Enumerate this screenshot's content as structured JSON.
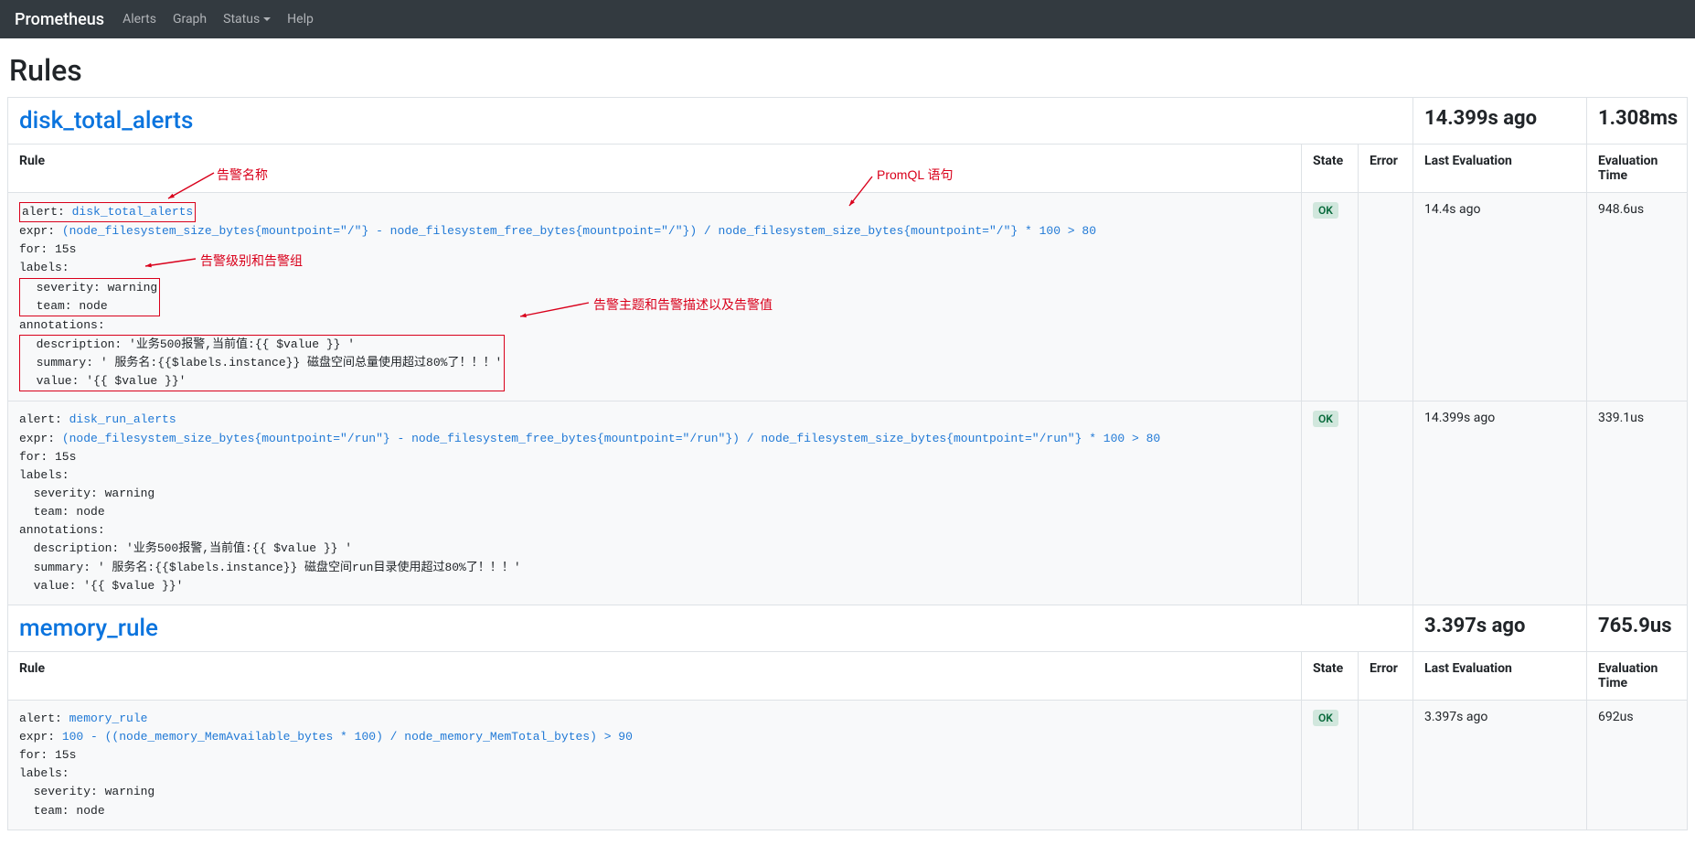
{
  "nav": {
    "brand": "Prometheus",
    "items": [
      "Alerts",
      "Graph",
      "Status",
      "Help"
    ]
  },
  "page_title": "Rules",
  "columns": {
    "rule": "Rule",
    "state": "State",
    "error": "Error",
    "last": "Last Evaluation",
    "eval": "Evaluation Time"
  },
  "state_ok": "OK",
  "annotations_ui": {
    "alert_name": "告警名称",
    "promql": "PromQL 语句",
    "level_group": "告警级别和告警组",
    "subject_desc": "告警主题和告警描述以及告警值"
  },
  "groups": [
    {
      "name": "disk_total_alerts",
      "ago": "14.399s ago",
      "duration": "1.308ms",
      "rules": [
        {
          "annotated": true,
          "state": "OK",
          "error": "",
          "last": "14.4s ago",
          "eval": "948.6us",
          "alert": "disk_total_alerts",
          "expr": "(node_filesystem_size_bytes{mountpoint=\"/\"} - node_filesystem_free_bytes{mountpoint=\"/\"}) / node_filesystem_size_bytes{mountpoint=\"/\"} * 100 > 80",
          "for": "15s",
          "labels": {
            "severity": "warning",
            "team": "node"
          },
          "annotations": {
            "description": "'业务500报警,当前值:{{ $value }} '",
            "summary": "' 服务名:{{$labels.instance}} 磁盘空间总量使用超过80%了！！！'",
            "value": "'{{ $value }}'"
          }
        },
        {
          "annotated": false,
          "state": "OK",
          "error": "",
          "last": "14.399s ago",
          "eval": "339.1us",
          "alert": "disk_run_alerts",
          "expr": "(node_filesystem_size_bytes{mountpoint=\"/run\"} - node_filesystem_free_bytes{mountpoint=\"/run\"}) / node_filesystem_size_bytes{mountpoint=\"/run\"} * 100 > 80",
          "for": "15s",
          "labels": {
            "severity": "warning",
            "team": "node"
          },
          "annotations": {
            "description": "'业务500报警,当前值:{{ $value }} '",
            "summary": "' 服务名:{{$labels.instance}} 磁盘空间run目录使用超过80%了！！！'",
            "value": "'{{ $value }}'"
          }
        }
      ]
    },
    {
      "name": "memory_rule",
      "ago": "3.397s ago",
      "duration": "765.9us",
      "rules": [
        {
          "annotated": false,
          "state": "OK",
          "error": "",
          "last": "3.397s ago",
          "eval": "692us",
          "alert": "memory_rule",
          "expr": "100 - ((node_memory_MemAvailable_bytes * 100) / node_memory_MemTotal_bytes) > 90",
          "for": "15s",
          "labels": {
            "severity": "warning",
            "team": "node"
          },
          "annotations": null
        }
      ]
    }
  ]
}
